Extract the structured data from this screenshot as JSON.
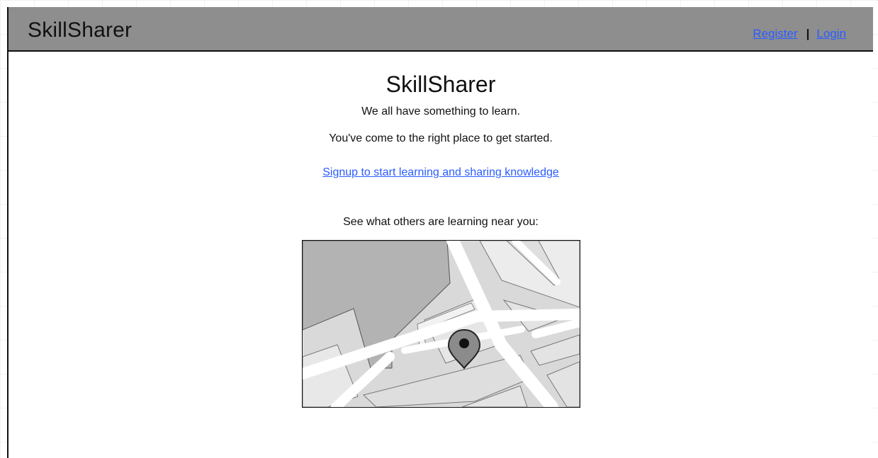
{
  "header": {
    "brand": "SkillSharer",
    "nav": {
      "register": "Register",
      "separator": "|",
      "login": "Login"
    }
  },
  "main": {
    "title": "SkillSharer",
    "tagline": "We all have something to learn.",
    "subline": "You've come to the right place to get started.",
    "signup_link": "Signup to start learning and sharing knowledge",
    "map_caption": "See what others are learning near you:"
  },
  "map": {
    "icon": "location-pin-icon"
  },
  "colors": {
    "header_bg": "#8e8e8e",
    "link": "#2a5cff"
  }
}
